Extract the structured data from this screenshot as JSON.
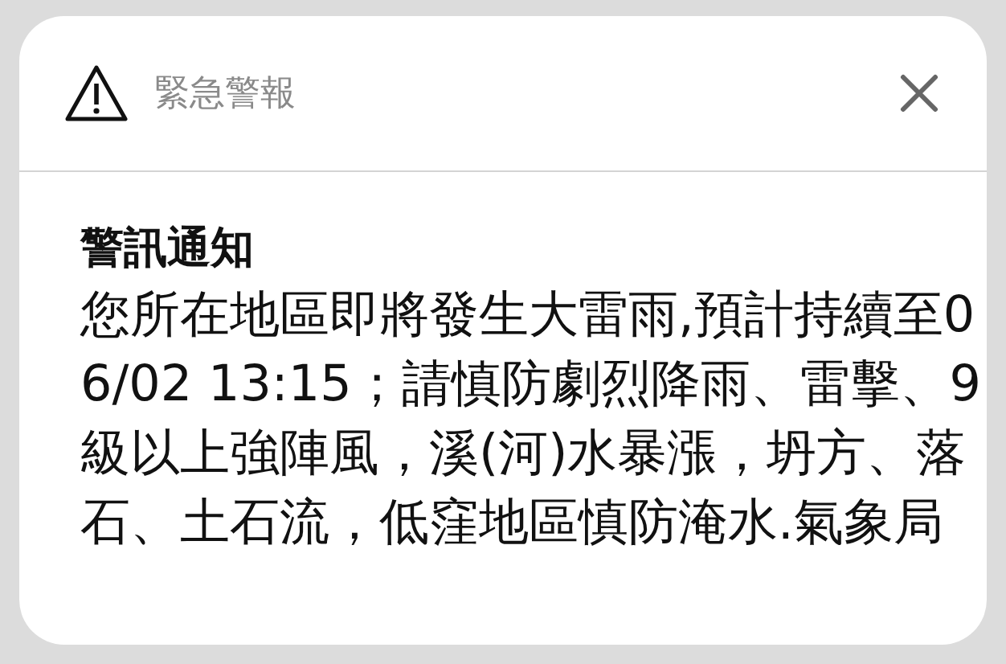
{
  "alert": {
    "app_name": "緊急警報",
    "title": "警訊通知",
    "message": "您所在地區即將發生大雷雨,預計持續至06/02 13:15；請慎防劇烈降雨、雷擊、9級以上強陣風，溪(河)水暴漲，坍方、落石、土石流，低窪地區慎防淹水.氣象局"
  }
}
